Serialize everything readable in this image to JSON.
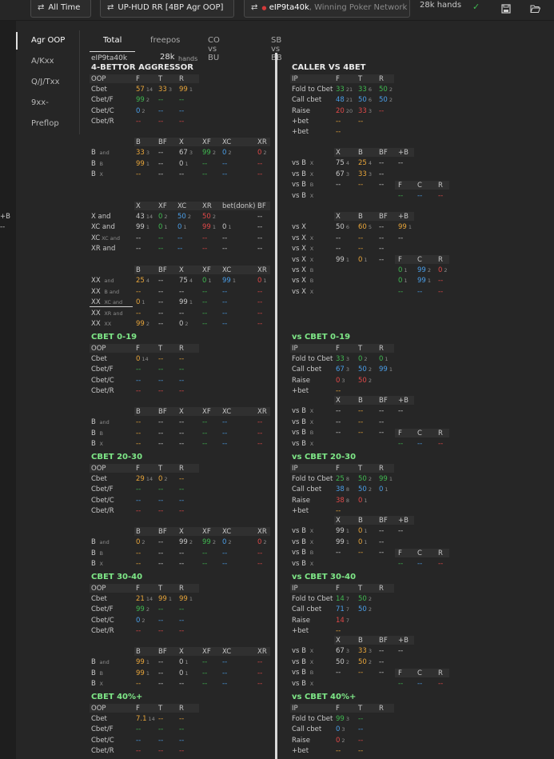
{
  "topbar": {
    "time_label": "All Time",
    "hud_label": "UP-HUD RR [4BP Agr OOP]",
    "player_label": "eIP9ta40k",
    "network_label": ", Winning Poker Network",
    "hands_label": "28k hands"
  },
  "sidebar": {
    "items": [
      "Agr OOP",
      "A/Kxx",
      "Q/J/Txx",
      "9xx-",
      "Preflop"
    ]
  },
  "tabs": [
    "Total",
    "freepos",
    "CO vs BU",
    "SB vs BB"
  ],
  "player": {
    "name": "eIP9ta40k",
    "hands": "28k",
    "hands_label": "hands"
  },
  "colors": {
    "orange": "#e8a53a",
    "green": "#3fb950",
    "blue": "#4a9ee8",
    "red": "#e04848",
    "title_green": "#7ee787"
  },
  "left_title": "4-BETTOR AGGRESSOR",
  "right_title": "CALLER VS 4BET",
  "sections": [
    {
      "title": "",
      "rtitle": ""
    },
    {
      "title": "CBET 0-19",
      "rtitle": "vs CBET 0-19"
    },
    {
      "title": "CBET 20-30",
      "rtitle": "vs CBET 20-30"
    },
    {
      "title": "CBET 30-40",
      "rtitle": "vs CBET 30-40"
    },
    {
      "title": "CBET 40%+",
      "rtitle": "vs CBET 40%+"
    }
  ]
}
